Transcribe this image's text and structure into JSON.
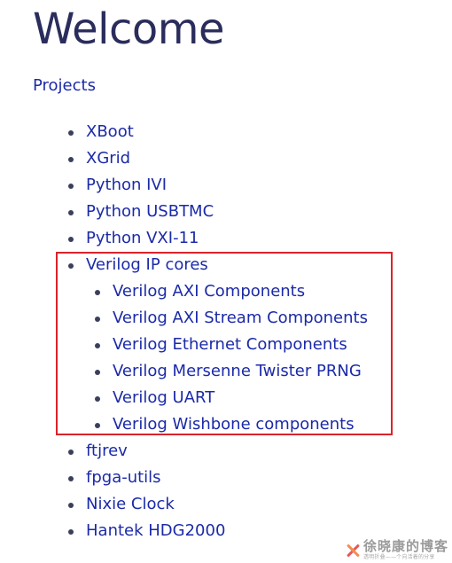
{
  "page": {
    "title": "Welcome",
    "projects_link": "Projects"
  },
  "projects": [
    {
      "label": "XBoot",
      "level": 1
    },
    {
      "label": "XGrid",
      "level": 1
    },
    {
      "label": "Python IVI",
      "level": 1
    },
    {
      "label": "Python USBTMC",
      "level": 1
    },
    {
      "label": "Python VXI-11",
      "level": 1
    },
    {
      "label": "Verilog IP cores",
      "level": 1
    },
    {
      "label": "Verilog AXI Components",
      "level": 2
    },
    {
      "label": "Verilog AXI Stream Components",
      "level": 2
    },
    {
      "label": "Verilog Ethernet Components",
      "level": 2
    },
    {
      "label": "Verilog Mersenne Twister PRNG",
      "level": 2
    },
    {
      "label": "Verilog UART",
      "level": 2
    },
    {
      "label": "Verilog Wishbone components",
      "level": 2
    },
    {
      "label": "ftjrev",
      "level": 1
    },
    {
      "label": "fpga-utils",
      "level": 1
    },
    {
      "label": "Nixie Clock",
      "level": 1
    },
    {
      "label": "Hantek HDG2000",
      "level": 1
    }
  ],
  "annotation": {
    "highlight_color": "#d9232b"
  },
  "watermark": {
    "name": "徐晓康的博客",
    "subtitle": "透明折叠——个向活着的分享"
  },
  "colors": {
    "title": "#2a2d5c",
    "link": "#1b2aa8",
    "bullet": "#3a3f5c"
  }
}
